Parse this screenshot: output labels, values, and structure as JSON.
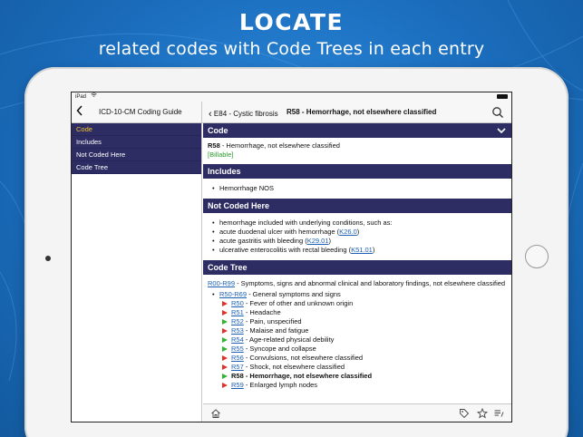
{
  "headline": {
    "title": "LOCATE",
    "subtitle": "related codes with Code Trees in each entry"
  },
  "status_bar": {
    "device": "iPad"
  },
  "nav": {
    "left_title": "ICD-10-CM Coding Guide",
    "breadcrumb": "E84 - Cystic fibrosis",
    "current_title": "R58 - Hemorrhage, not elsewhere classified"
  },
  "sidebar": {
    "items": [
      {
        "label": "Code",
        "active": true
      },
      {
        "label": "Includes",
        "active": false
      },
      {
        "label": "Not Coded Here",
        "active": false
      },
      {
        "label": "Code Tree",
        "active": false
      }
    ]
  },
  "sections": {
    "code": {
      "header": "Code",
      "code": "R58",
      "description": " - Hemorrhage, not elsewhere classified",
      "billable": "[Billable]"
    },
    "includes": {
      "header": "Includes",
      "items": [
        "Hemorrhage NOS"
      ]
    },
    "not_coded": {
      "header": "Not Coded Here",
      "items": [
        {
          "text": "hemorrhage included with underlying conditions, such as:",
          "pre": "",
          "link": "",
          "post": ""
        },
        {
          "text": "",
          "pre": "acute duodenal ulcer with hemorrhage (",
          "link": "K26.0",
          "post": ")"
        },
        {
          "text": "",
          "pre": "acute gastritis with bleeding (",
          "link": "K29.01",
          "post": ")"
        },
        {
          "text": "",
          "pre": "ulcerative enterocolitis with rectal bleeding (",
          "link": "K51.01",
          "post": ")"
        }
      ]
    },
    "code_tree": {
      "header": "Code Tree",
      "root": {
        "link": "R00-R99",
        "text": " - Symptoms, signs and abnormal clinical and laboratory findings, not elsewhere classified"
      },
      "group": {
        "link": "R50-R69",
        "text": " - General symptoms and signs"
      },
      "children": [
        {
          "link": "R50",
          "text": " - Fever of other and unknown origin",
          "marker": "red",
          "current": false
        },
        {
          "link": "R51",
          "text": " - Headache",
          "marker": "red",
          "current": false
        },
        {
          "link": "R52",
          "text": " - Pain, unspecified",
          "marker": "green",
          "current": false
        },
        {
          "link": "R53",
          "text": " - Malaise and fatigue",
          "marker": "red",
          "current": false
        },
        {
          "link": "R54",
          "text": " - Age-related physical debility",
          "marker": "green",
          "current": false
        },
        {
          "link": "R55",
          "text": " - Syncope and collapse",
          "marker": "green",
          "current": false
        },
        {
          "link": "R56",
          "text": " - Convulsions, not elsewhere classified",
          "marker": "red",
          "current": false
        },
        {
          "link": "R57",
          "text": " - Shock, not elsewhere classified",
          "marker": "red",
          "current": false
        },
        {
          "link": "R58",
          "text": " - Hemorrhage, not elsewhere classified",
          "marker": "green",
          "current": true
        },
        {
          "link": "R59",
          "text": " - Enlarged lymph nodes",
          "marker": "red",
          "current": false
        }
      ]
    }
  },
  "icons": {
    "back": "chevron-left-icon",
    "search": "search-icon",
    "collapse": "chevron-down-icon",
    "home": "home-icon",
    "tag": "tag-icon",
    "star": "star-icon",
    "notes": "notes-icon"
  },
  "colors": {
    "header_bg": "#2e2d63",
    "active_item": "#f5c22b",
    "billable": "#2a9a2a",
    "link": "#1b5fb5",
    "marker_red": "#e0302a",
    "marker_green": "#2fb52f",
    "background": "#1f74c4"
  }
}
